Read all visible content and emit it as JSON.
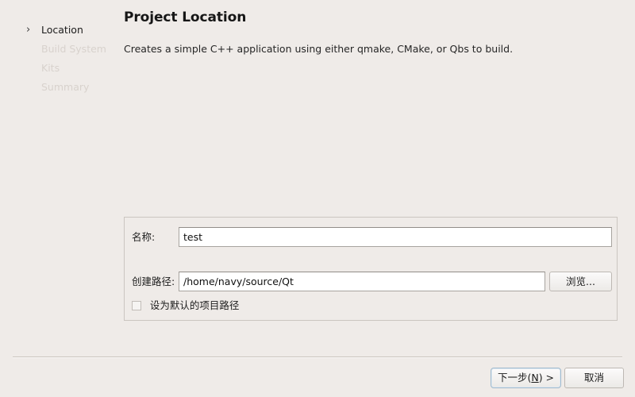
{
  "window": {
    "background_color": "#efebe8"
  },
  "sidebar": {
    "items": [
      {
        "label": "Location",
        "state": "active",
        "chevron": "›"
      },
      {
        "label": "Build System",
        "state": "upcoming"
      },
      {
        "label": "Kits",
        "state": "upcoming"
      },
      {
        "label": "Summary",
        "state": "upcoming"
      }
    ]
  },
  "main": {
    "title": "Project Location",
    "description": "Creates a simple C++ application using either qmake, CMake, or Qbs to build."
  },
  "form": {
    "name": {
      "label": "名称:",
      "value": "test",
      "placeholder": ""
    },
    "path": {
      "label": "创建路径:",
      "value": "/home/navy/source/Qt",
      "placeholder": ""
    },
    "browse_button": "浏览...",
    "default_path_checkbox": {
      "label": "设为默认的项目路径",
      "checked": false
    }
  },
  "footer": {
    "next_button": {
      "text_before": "下一步(",
      "mnemonic": "N",
      "text_after": ") >",
      "is_default": true,
      "focus_color": "#9fb9cd"
    },
    "cancel_button": "取消"
  }
}
